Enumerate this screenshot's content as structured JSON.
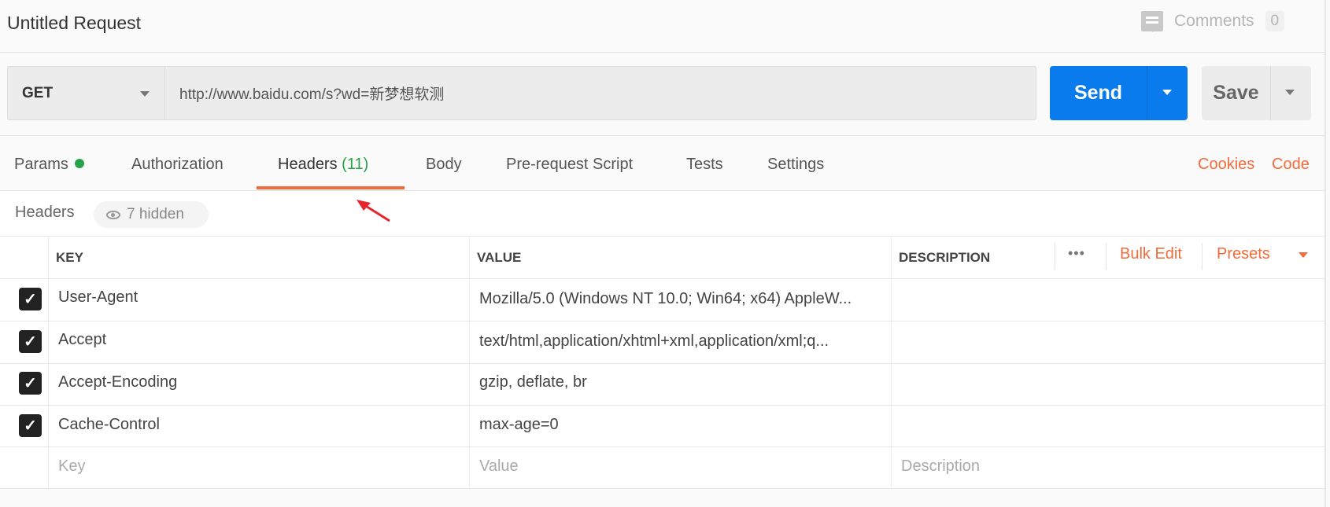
{
  "title": "Untitled Request",
  "comments": {
    "label": "Comments",
    "count": "0"
  },
  "request": {
    "method": "GET",
    "url": "http://www.baidu.com/s?wd=新梦想软测",
    "send_label": "Send",
    "save_label": "Save"
  },
  "tabs": [
    {
      "label": "Params"
    },
    {
      "label": "Authorization"
    },
    {
      "label": "Headers",
      "count": "(11)"
    },
    {
      "label": "Body"
    },
    {
      "label": "Pre-request Script"
    },
    {
      "label": "Tests"
    },
    {
      "label": "Settings"
    }
  ],
  "active_tab": "Headers",
  "links": {
    "cookies": "Cookies",
    "code": "Code"
  },
  "headers_section": {
    "title": "Headers",
    "hidden": "7 hidden"
  },
  "table": {
    "columns": [
      "KEY",
      "VALUE",
      "DESCRIPTION"
    ],
    "actions": {
      "more": "•••",
      "bulk_edit": "Bulk Edit",
      "presets": "Presets"
    },
    "rows": [
      {
        "checked": true,
        "key": "User-Agent",
        "value": "Mozilla/5.0 (Windows NT 10.0; Win64; x64) AppleW..."
      },
      {
        "checked": true,
        "key": "Accept",
        "value": "text/html,application/xhtml+xml,application/xml;q..."
      },
      {
        "checked": true,
        "key": "Accept-Encoding",
        "value": "gzip, deflate, br"
      },
      {
        "checked": true,
        "key": "Cache-Control",
        "value": "max-age=0"
      }
    ],
    "placeholders": {
      "key": "Key",
      "value": "Value",
      "description": "Description"
    }
  },
  "colors": {
    "send": "#097bed",
    "accent": "#f26b3a",
    "params_dot": "#26a24a"
  }
}
